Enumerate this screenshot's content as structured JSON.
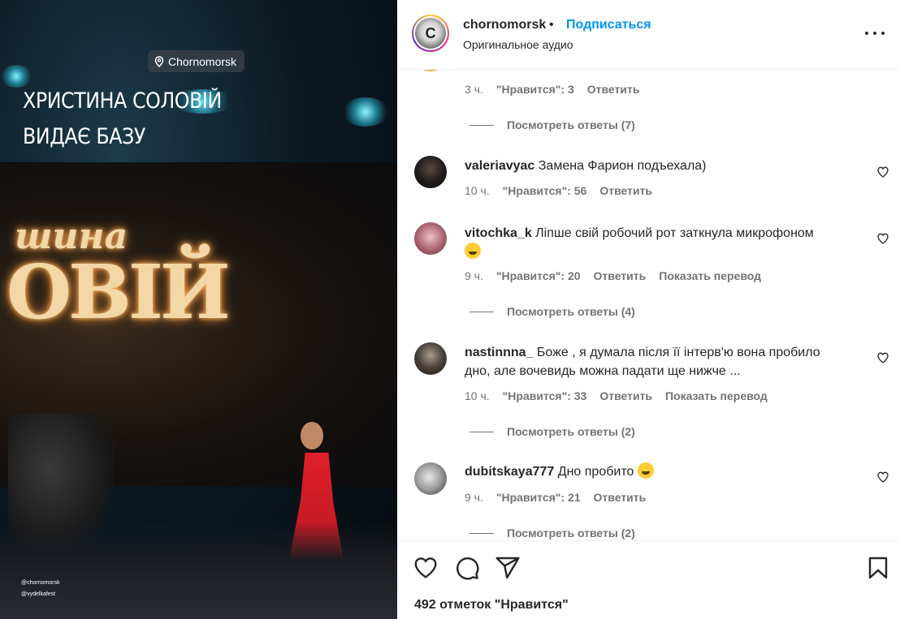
{
  "media": {
    "location": "Chornomorsk",
    "overlay_line1": "ХРИСТИНА СОЛОВІЙ",
    "overlay_line2": "ВИДАЄ БАЗУ",
    "stage_logo_top": "шина",
    "stage_logo_bottom": "ОВІЙ",
    "credits": [
      "@chornomorsk",
      "@vydelkafest"
    ]
  },
  "header": {
    "username": "chornomorsk",
    "separator": "•",
    "follow_label": "Подписаться",
    "audio_label": "Оригинальное аудио"
  },
  "comments": {
    "first_meta": {
      "time": "3 ч.",
      "likes": "\"Нравится\": 3",
      "reply": "Ответить"
    },
    "first_replies": "Посмотреть ответы (7)",
    "items": [
      {
        "user": "valeriavyac",
        "text": "Замена Фарион подъехала)",
        "time": "10 ч.",
        "likes": "\"Нравится\": 56",
        "reply": "Ответить"
      },
      {
        "user": "vitochka_k",
        "text": "Ліпше свій робочий рот заткнула микрофоном",
        "emoji": "😅",
        "time": "9 ч.",
        "likes": "\"Нравится\": 20",
        "reply": "Ответить",
        "translate": "Показать перевод",
        "replies": "Посмотреть ответы (4)"
      },
      {
        "user": "nastinnna_",
        "text": "Боже , я думала після її інтерв'ю вона пробило",
        "text2": "дно, але вочевидь можна падати ще нижче ...",
        "time": "10 ч.",
        "likes": "\"Нравится\": 33",
        "reply": "Ответить",
        "translate": "Показать перевод",
        "replies": "Посмотреть ответы (2)"
      },
      {
        "user": "dubitskaya777",
        "text": "Дно пробито",
        "emoji": "😁",
        "time": "9 ч.",
        "likes": "\"Нравится\": 21",
        "reply": "Ответить",
        "replies": "Посмотреть ответы (2)"
      }
    ]
  },
  "footer": {
    "likes_count": "492 отметок \"Нравится\""
  },
  "colors": {
    "accent": "#0095f6",
    "text": "#262626",
    "secondary": "#737373"
  },
  "icons": [
    "location-pin-icon",
    "more-icon",
    "heart-icon",
    "comment-icon",
    "share-icon",
    "bookmark-icon"
  ]
}
